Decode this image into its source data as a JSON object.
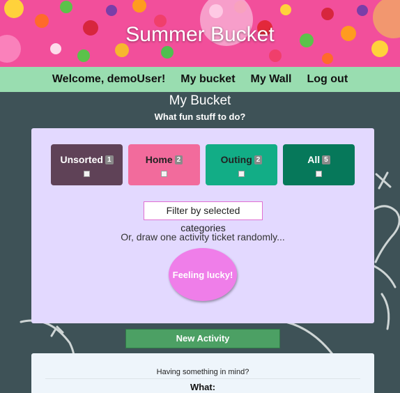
{
  "header": {
    "title": "Summer Bucket"
  },
  "nav": {
    "items": [
      {
        "label": "Welcome, demoUser!"
      },
      {
        "label": "My bucket"
      },
      {
        "label": "My Wall"
      },
      {
        "label": "Log out"
      }
    ]
  },
  "page": {
    "title": "My Bucket",
    "subtitle": "What fun stuff to do?"
  },
  "categories": [
    {
      "label": "Unsorted",
      "count": "1",
      "color": "#5f4257",
      "text_color": "#ffffff"
    },
    {
      "label": "Home",
      "count": "2",
      "color": "#f26b9c",
      "text_color": "#222222"
    },
    {
      "label": "Outing",
      "count": "2",
      "color": "#12ad86",
      "text_color": "#222222"
    },
    {
      "label": "All",
      "count": "5",
      "color": "#06785a",
      "text_color": "#ffffff"
    }
  ],
  "filter": {
    "label": "Filter by selected categories"
  },
  "draw": {
    "text": "Or, draw one activity ticket randomly...",
    "button_label": "Feeling lucky!"
  },
  "new_activity": {
    "label": "New Activity"
  },
  "form": {
    "hint": "Having something in mind?",
    "what_label": "What:"
  },
  "colors": {
    "nav_bg": "#99ddb0",
    "panel_bg": "#e3d9ff",
    "board_bg": "#3e5257",
    "lucky": "#ef7ee9",
    "new_activity": "#4ca064"
  }
}
